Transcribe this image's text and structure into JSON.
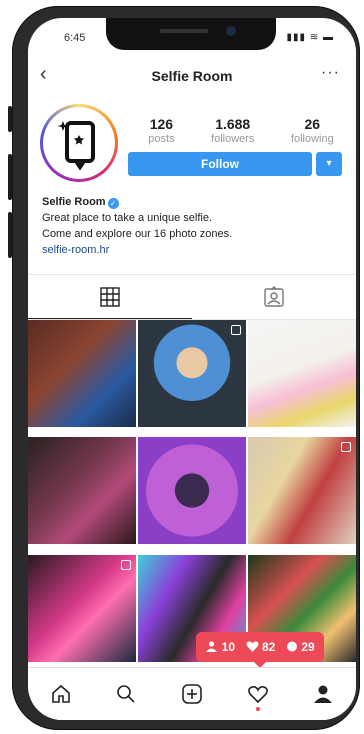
{
  "status": {
    "time": "6:45",
    "icons": "▮▮▮ ≋ ▬"
  },
  "header": {
    "title": "Selfie Room",
    "back": "‹",
    "more": "···"
  },
  "profile": {
    "stats": [
      {
        "num": "126",
        "label": "posts"
      },
      {
        "num": "1.688",
        "label": "followers"
      },
      {
        "num": "26",
        "label": "following"
      }
    ],
    "follow_label": "Follow",
    "dropdown_glyph": "▾",
    "name": "Selfie Room",
    "verified_glyph": "✓",
    "bio_line1": "Great place to take a unique selfie.",
    "bio_line2": "Come and explore our 16 photo zones.",
    "link": "selfie-room.hr"
  },
  "tabs": [
    {
      "icon": "grid-icon"
    },
    {
      "icon": "tagged-icon"
    }
  ],
  "grid": [
    {
      "icon": "photo",
      "multi": false
    },
    {
      "icon": "photo",
      "multi": true
    },
    {
      "icon": "photo",
      "multi": false
    },
    {
      "icon": "photo",
      "multi": false
    },
    {
      "icon": "photo",
      "multi": false
    },
    {
      "icon": "photo",
      "multi": true
    },
    {
      "icon": "photo",
      "multi": true
    },
    {
      "icon": "photo",
      "multi": false
    },
    {
      "icon": "photo",
      "multi": false
    }
  ],
  "notification": {
    "followers": "10",
    "likes": "82",
    "comments": "29"
  },
  "nav": [
    "home-icon",
    "search-icon",
    "add-icon",
    "heart-icon",
    "profile-icon"
  ],
  "colors": {
    "accent": "#3897f0",
    "notification": "#ed4956"
  }
}
